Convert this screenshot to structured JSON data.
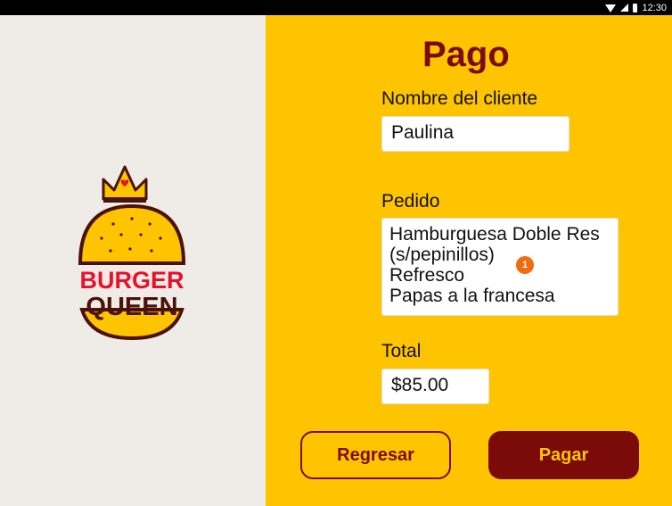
{
  "status_bar": {
    "time": "12:30"
  },
  "brand": {
    "line1": "BURGER",
    "line2": "QUEEN"
  },
  "header": {
    "title": "Pago"
  },
  "form": {
    "customer_label": "Nombre del cliente",
    "customer_value": "Paulina",
    "order_label": "Pedido",
    "order_lines": [
      "Hamburguesa Doble Res",
      "(s/pepinillos)",
      "Refresco",
      "Papas a la francesa"
    ],
    "order_badge": "1",
    "total_label": "Total",
    "total_value": "$85.00"
  },
  "actions": {
    "back_label": "Regresar",
    "pay_label": "Pagar"
  },
  "colors": {
    "brand_red": "#7a0b08",
    "accent_yellow": "#ffc400",
    "panel_gray": "#efebe6"
  },
  "icons": [
    "wifi-icon",
    "signal-icon",
    "battery-icon"
  ]
}
